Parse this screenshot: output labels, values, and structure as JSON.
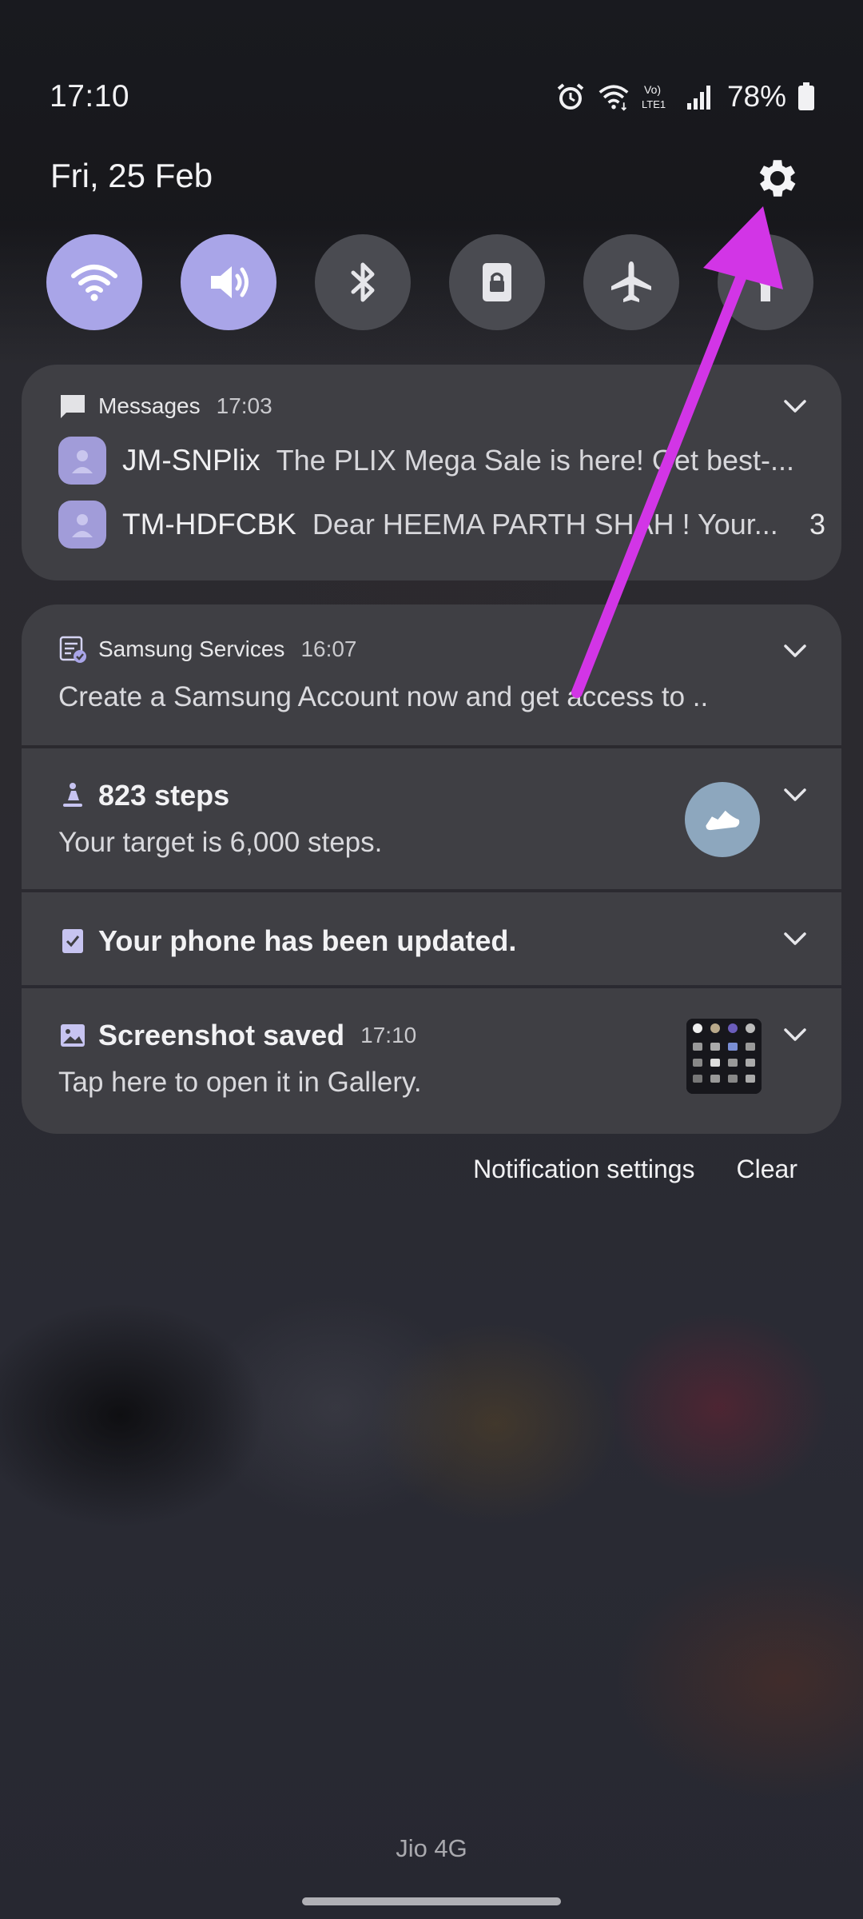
{
  "status_bar": {
    "time": "17:10",
    "battery": "78%",
    "icons": [
      "alarm-icon",
      "wifi-icon",
      "volte-icon",
      "signal-icon",
      "battery-icon"
    ],
    "volte_label_top": "Vo)",
    "volte_label_bottom": "LTE1"
  },
  "header": {
    "date": "Fri, 25 Feb",
    "settings_icon": "gear-icon"
  },
  "quick_settings": [
    {
      "name": "wifi",
      "icon": "wifi-icon",
      "active": true
    },
    {
      "name": "sound",
      "icon": "speaker-icon",
      "active": true
    },
    {
      "name": "bluetooth",
      "icon": "bluetooth-icon",
      "active": false
    },
    {
      "name": "rotation-lock",
      "icon": "lock-icon",
      "active": false
    },
    {
      "name": "airplane",
      "icon": "airplane-icon",
      "active": false
    },
    {
      "name": "flashlight",
      "icon": "flashlight-icon",
      "active": false
    }
  ],
  "notifications": {
    "messages": {
      "app": "Messages",
      "time": "17:03",
      "items": [
        {
          "sender": "JM-SNPlix",
          "preview": "The PLIX Mega Sale is here! Get best-..."
        },
        {
          "sender": "TM-HDFCBK",
          "preview": "Dear HEEMA PARTH SHAH ! Your...",
          "count": "3"
        }
      ]
    },
    "samsung": {
      "app": "Samsung Services",
      "time": "16:07",
      "body": "Create a Samsung Account now and get access to .."
    },
    "steps": {
      "title": "823 steps",
      "body": "Your target is 6,000 steps."
    },
    "update": {
      "title": "Your phone has been updated."
    },
    "screenshot": {
      "title": "Screenshot saved",
      "time": "17:10",
      "body": "Tap here to open it in Gallery."
    }
  },
  "actions": {
    "settings": "Notification settings",
    "clear": "Clear"
  },
  "carrier": "Jio 4G",
  "colors": {
    "accent": "#a9a5e8",
    "arrow": "#d235e6",
    "card": "#3f3f44"
  }
}
